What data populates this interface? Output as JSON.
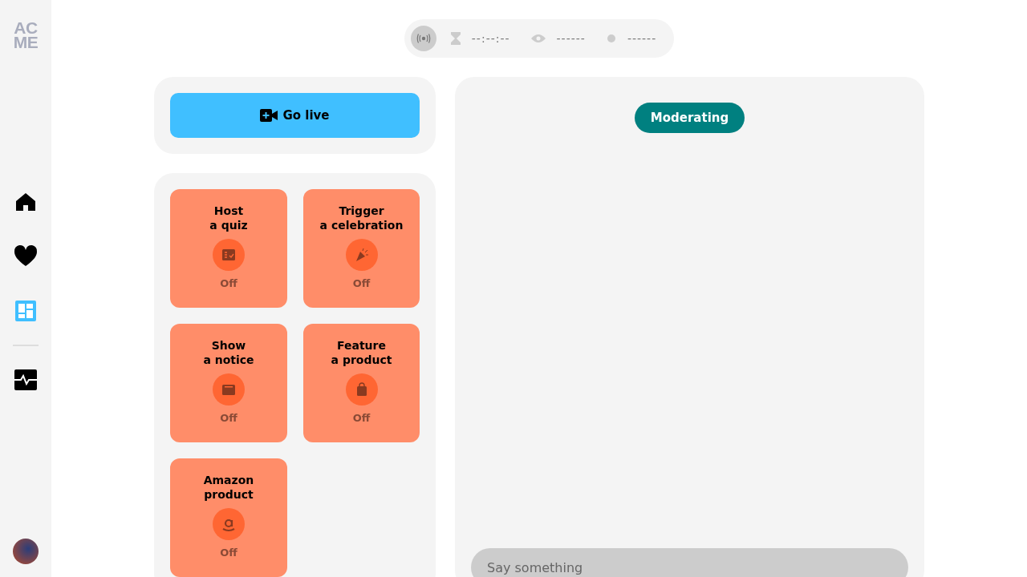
{
  "logo": {
    "lines": [
      "AC",
      "ME"
    ]
  },
  "sidebar": {
    "items": [
      {
        "kind": "home",
        "selected": false
      },
      {
        "kind": "heart",
        "selected": false
      },
      {
        "kind": "dashboard",
        "selected": true
      },
      {
        "kind": "divider"
      },
      {
        "kind": "activity",
        "selected": false
      }
    ]
  },
  "status": {
    "live": false,
    "timer": "--:--:--",
    "viewers": "------",
    "dot": "------"
  },
  "go_live": {
    "label": "Go live"
  },
  "tiles": [
    {
      "kind": "quiz",
      "lines": [
        "Host",
        "a quiz"
      ],
      "status": "Off",
      "on": false
    },
    {
      "kind": "celebration",
      "lines": [
        "Trigger",
        "a celebration"
      ],
      "status": "Off",
      "on": false
    },
    {
      "kind": "notice",
      "lines": [
        "Show",
        "a notice"
      ],
      "status": "Off",
      "on": false
    },
    {
      "kind": "product",
      "lines": [
        "Feature",
        "a product"
      ],
      "status": "Off",
      "on": false
    },
    {
      "kind": "amazon",
      "lines": [
        "Amazon",
        "product"
      ],
      "status": "Off",
      "on": false
    }
  ],
  "chat": {
    "badge": "Moderating",
    "placeholder": "Say something"
  }
}
